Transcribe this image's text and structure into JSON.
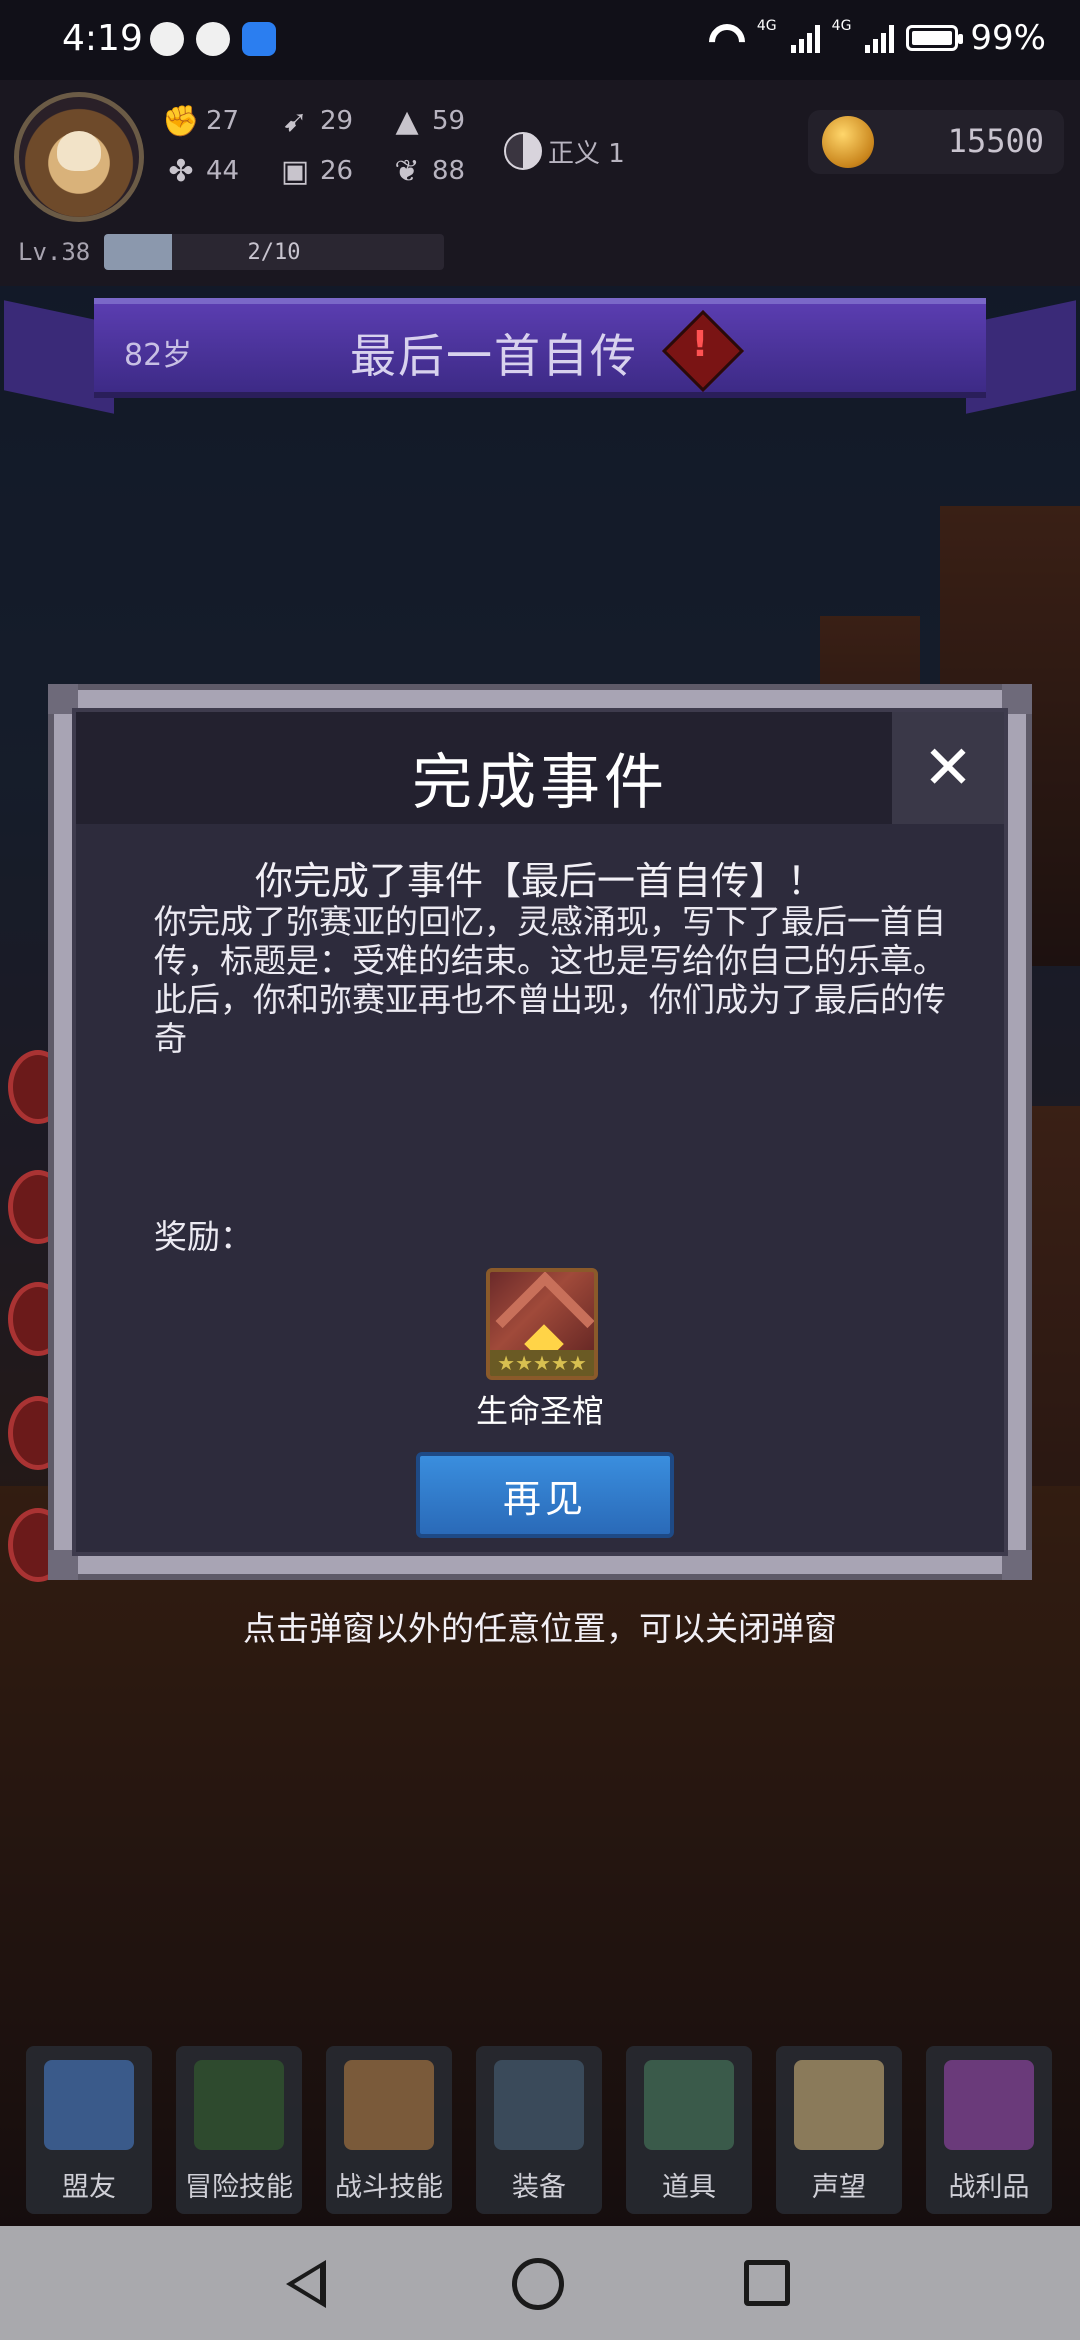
{
  "status_bar": {
    "time": "4:19",
    "battery_level": 0.99,
    "battery_text": "99%",
    "network": "4G"
  },
  "player": {
    "stats": [
      {
        "icon": "fist-icon",
        "value": "27"
      },
      {
        "icon": "clover-icon",
        "value": "44"
      },
      {
        "icon": "boot-icon",
        "value": "29"
      },
      {
        "icon": "armor-icon",
        "value": "26"
      },
      {
        "icon": "wizard-hat-icon",
        "value": "59"
      },
      {
        "icon": "lotus-icon",
        "value": "88"
      }
    ],
    "alignment_label": "正义 1",
    "gold": "15500",
    "level": "Lv.38",
    "xp_text": "2/10",
    "xp_progress": 0.2
  },
  "banner": {
    "age": "82岁",
    "title": "最后一首自传",
    "alert_mark": "!"
  },
  "modal": {
    "title": "完成事件",
    "close_symbol": "✕",
    "subtitle": "你完成了事件【最后一首自传】！",
    "body": "你完成了弥赛亚的回忆，灵感涌现，写下了最后一首自传，标题是：受难的结束。这也是写给你自己的乐章。此后，你和弥赛亚再也不曾出现，你们成为了最后的传奇",
    "reward_label": "奖励：",
    "reward_item_name": "生命圣棺",
    "reward_item_stars": "★★★★★",
    "button_label": "再见"
  },
  "hint": "点击弹窗以外的任意位置，可以关闭弹窗",
  "bottom_nav": [
    {
      "label": "盟友",
      "icon": "gloves-icon",
      "color": "#3a5a8a"
    },
    {
      "label": "冒险技能",
      "icon": "book-icon",
      "color": "#2e4a2e"
    },
    {
      "label": "战斗技能",
      "icon": "backpack-icon",
      "color": "#7a5a3a"
    },
    {
      "label": "装备",
      "icon": "crossed-swords-icon",
      "color": "#3a4a5a"
    },
    {
      "label": "道具",
      "icon": "satchel-icon",
      "color": "#3a5a4a"
    },
    {
      "label": "声望",
      "icon": "scroll-icon",
      "color": "#8a7a5a"
    },
    {
      "label": "战利品",
      "icon": "treasure-chest-icon",
      "color": "#6a3a7a"
    }
  ]
}
